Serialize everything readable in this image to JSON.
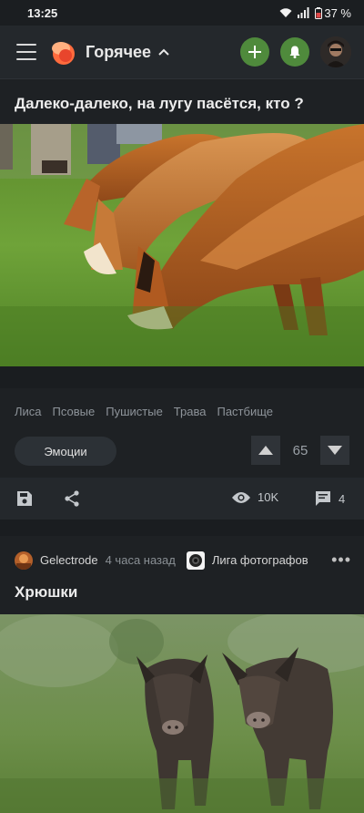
{
  "status_bar": {
    "time": "13:25",
    "battery": "37 %"
  },
  "header": {
    "feed_title": "Горячее",
    "add_icon": "plus-icon",
    "notifications_icon": "bell-icon"
  },
  "post1": {
    "title": "Далеко-далеко, на лугу пасётся, кто ?",
    "tags": [
      "Лиса",
      "Псовые",
      "Пушистые",
      "Трава",
      "Пастбище"
    ],
    "emotions_label": "Эмоции",
    "rating": "65",
    "views": "10K",
    "comments": "4"
  },
  "post2": {
    "author": "Gelectrode",
    "time_ago": "4 часа назад",
    "community": "Лига фотографов",
    "title": "Хрюшки"
  },
  "colors": {
    "accent_green": "#4f8a3c",
    "background": "#1e2124",
    "bar": "#24282c"
  }
}
